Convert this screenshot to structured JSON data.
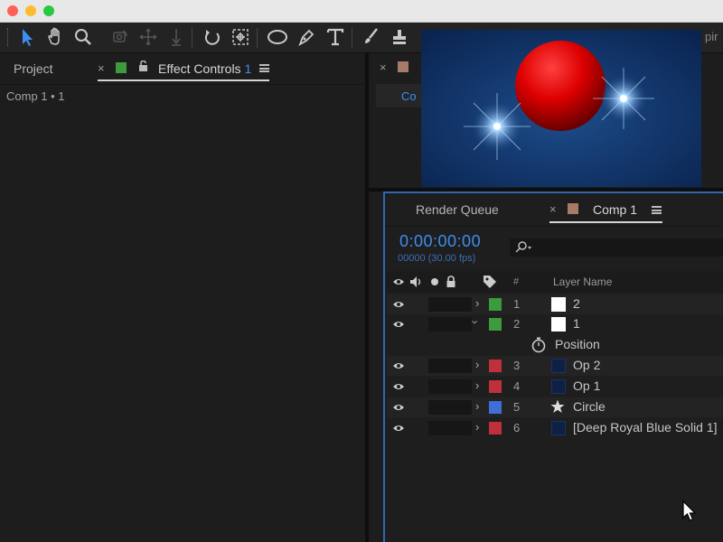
{
  "toolbar": {
    "tools": [
      "selection-tool",
      "hand-tool",
      "zoom-tool",
      "orbit-camera-tool",
      "pan-tool",
      "dolly-tool",
      "rotation-tool",
      "anchor-point-tool",
      "ellipse-tool",
      "pen-tool",
      "type-tool",
      "brush-tool",
      "clone-stamp-tool"
    ],
    "right_fragment": "pir"
  },
  "left_panel": {
    "project_tab": "Project",
    "effect_controls_tab": "Effect Controls",
    "effect_controls_count": "1",
    "breadcrumb": "Comp 1 • 1"
  },
  "viewer": {
    "tab_label_fragment": "Co"
  },
  "timeline": {
    "render_queue_tab": "Render Queue",
    "comp_tab": "Comp 1",
    "timecode": "0:00:00:00",
    "frames": "00000 (30.00 fps)",
    "search_placeholder": "",
    "header_hash": "#",
    "header_layer_name": "Layer Name",
    "layers": [
      {
        "num": "1",
        "name": "2",
        "label_color": "#3c9b3c",
        "icon": "white",
        "expanded": false
      },
      {
        "num": "2",
        "name": "1",
        "label_color": "#3c9b3c",
        "icon": "white",
        "expanded": true
      },
      {
        "num": "3",
        "name": "Op 2",
        "label_color": "#c0303a",
        "icon": "navy",
        "expanded": false
      },
      {
        "num": "4",
        "name": "Op 1",
        "label_color": "#c0303a",
        "icon": "navy",
        "expanded": false
      },
      {
        "num": "5",
        "name": "Circle",
        "label_color": "#3f6fd6",
        "icon": "star",
        "expanded": false
      },
      {
        "num": "6",
        "name": "[Deep Royal Blue Solid 1]",
        "label_color": "#c0303a",
        "icon": "navy",
        "expanded": false
      }
    ],
    "property_name": "Position"
  },
  "colors": {
    "accent_blue": "#3d8ef0",
    "panel_bg": "#1d1d1d",
    "timeline_border": "#2f67b3",
    "comp_swatch": "#a87a6a",
    "effect_swatch": "#3c9b3c"
  }
}
